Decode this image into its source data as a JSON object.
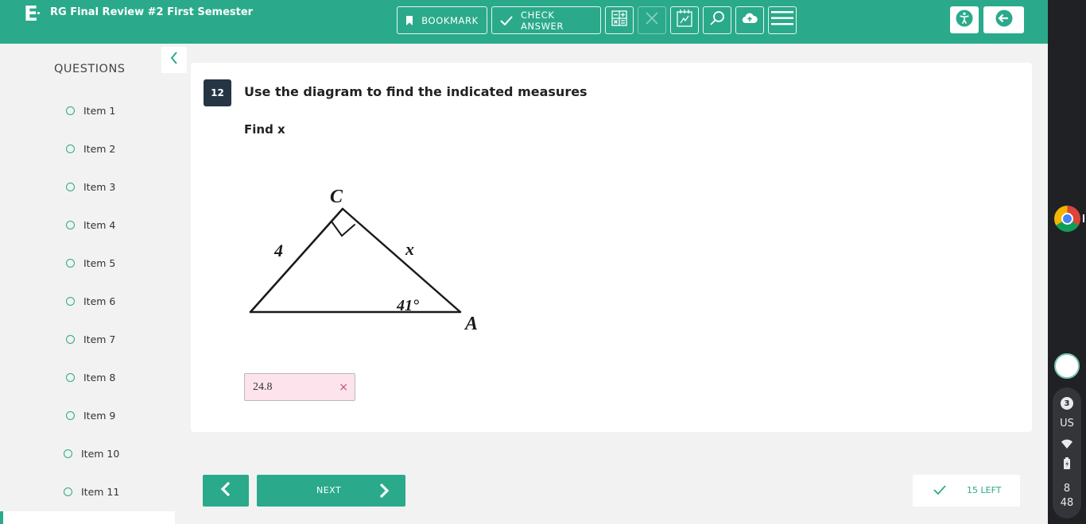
{
  "header": {
    "logo": "E",
    "title": "RG Final Review #2 First Semester",
    "bookmark_label": "BOOKMARK",
    "check_answer_label": "CHECK ANSWER"
  },
  "sidebar": {
    "title": "QUESTIONS",
    "items": [
      "Item 1",
      "Item 2",
      "Item 3",
      "Item 4",
      "Item 5",
      "Item 6",
      "Item 7",
      "Item 8",
      "Item 9",
      "Item 10",
      "Item 11"
    ]
  },
  "question": {
    "number": "12",
    "title": "Use the diagram to find the indicated measures",
    "subtitle": "Find x",
    "diagram": {
      "vertex_c": "C",
      "vertex_a": "A",
      "side_left": "4",
      "side_right": "x",
      "angle": "41°"
    },
    "answer": "24.8",
    "clear_symbol": "×"
  },
  "navigation": {
    "next_label": "NEXT",
    "left_label": "15 LEFT"
  },
  "shelf": {
    "notification_count": "3",
    "locale": "US",
    "time_hour": "8",
    "time_minute": "48"
  },
  "colors": {
    "accent": "#2aaa8a",
    "dark_badge": "#263544",
    "answer_bg": "#fde3ec",
    "shelf_bg": "#202124"
  }
}
